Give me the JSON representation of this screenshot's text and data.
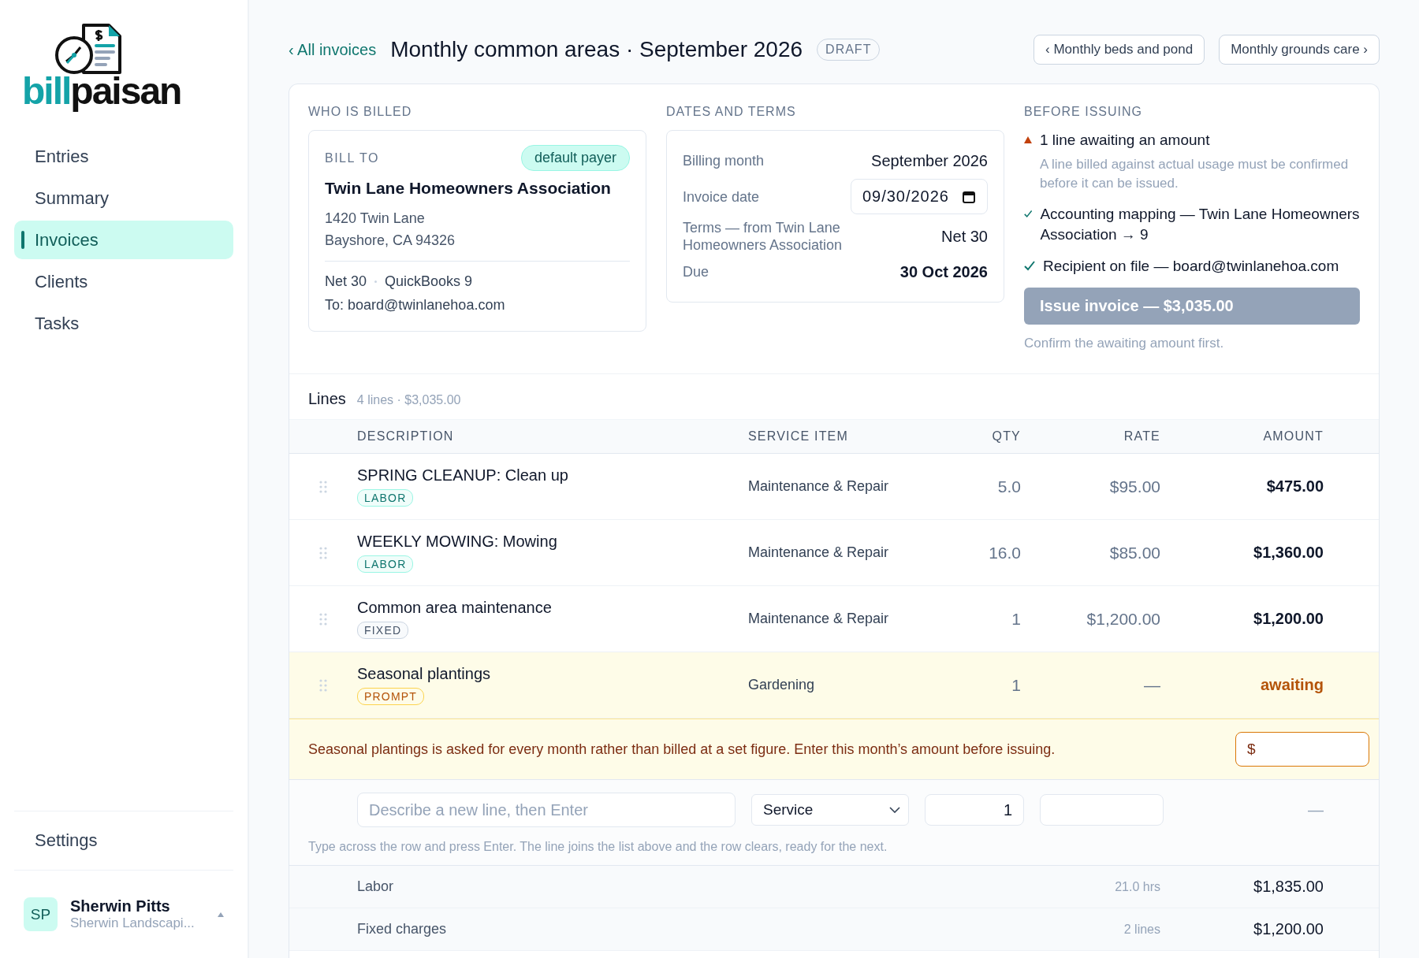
{
  "logo": {
    "part_a": "bill",
    "part_b": "paisan"
  },
  "sidebar": {
    "items": [
      {
        "label": "Entries",
        "selected": false
      },
      {
        "label": "Summary",
        "selected": false
      },
      {
        "label": "Invoices",
        "selected": true
      },
      {
        "label": "Clients",
        "selected": false
      },
      {
        "label": "Tasks",
        "selected": false
      }
    ],
    "settings": "Settings",
    "user": {
      "initials": "SP",
      "name": "Sherwin Pitts",
      "company": "Sherwin Landscapi..."
    }
  },
  "header": {
    "back_link": "‹ All invoices",
    "title": "Monthly common areas · September 2026",
    "status": "DRAFT",
    "prev": "‹ Monthly beds and pond",
    "next": "Monthly grounds care ›"
  },
  "who_is_billed": {
    "heading": "WHO IS BILLED",
    "label": "BILL TO",
    "badge": "default payer",
    "name": "Twin Lane Homeowners Association",
    "address": [
      "1420 Twin Lane",
      "Bayshore, CA 94326"
    ],
    "terms": "Net 30",
    "mapping": "QuickBooks 9",
    "recipient": "To: board@twinlanehoa.com"
  },
  "dates_and_terms": {
    "heading": "DATES AND TERMS",
    "rows": [
      {
        "kind": "text",
        "label": "Billing month",
        "value": "September 2026",
        "strong": false
      },
      {
        "kind": "date",
        "label": "Invoice date",
        "value": "09/30/2026"
      },
      {
        "kind": "text",
        "label": "Terms — from Twin Lane Homeowners Association",
        "value": "Net 30",
        "strong": false
      },
      {
        "kind": "text",
        "label": "Due",
        "value": "30 Oct 2026",
        "strong": true
      }
    ]
  },
  "before_issuing": {
    "heading": "BEFORE ISSUING",
    "checks": [
      {
        "kind": "warning",
        "text": "1 line awaiting an amount",
        "note": "A line billed against actual usage must be confirmed before it can be issued."
      },
      {
        "kind": "ok",
        "text": "Accounting mapping — Twin Lane Homeowners Association → 9"
      },
      {
        "kind": "ok",
        "text": "Recipient on file — board@twinlanehoa.com"
      }
    ],
    "button": {
      "label": "Issue invoice — $3,035.00",
      "disabled": true
    },
    "hint": "Confirm the awaiting amount first."
  },
  "lines": {
    "title": "Lines",
    "summary": "4 lines · $3,035.00",
    "columns": [
      "DESCRIPTION",
      "SERVICE ITEM",
      "QTY",
      "RATE",
      "AMOUNT"
    ],
    "rows": [
      {
        "description": "SPRING CLEANUP: Clean up",
        "tag": "LABOR",
        "kind": "labor",
        "service_item": "Maintenance & Repair",
        "qty": "5.0",
        "rate": "$95.00",
        "amount": "$475.00",
        "awaiting": false
      },
      {
        "description": "WEEKLY MOWING: Mowing",
        "tag": "LABOR",
        "kind": "labor",
        "service_item": "Maintenance & Repair",
        "qty": "16.0",
        "rate": "$85.00",
        "amount": "$1,360.00",
        "awaiting": false
      },
      {
        "description": "Common area maintenance",
        "tag": "FIXED",
        "kind": "fixed",
        "service_item": "Maintenance & Repair",
        "qty": "1",
        "rate": "$1,200.00",
        "amount": "$1,200.00",
        "awaiting": false
      },
      {
        "description": "Seasonal plantings",
        "tag": "PROMPT",
        "kind": "prompt",
        "service_item": "Gardening",
        "qty": "1",
        "rate": "—",
        "amount": "awaiting",
        "awaiting": true
      }
    ],
    "notice": {
      "text": "Seasonal plantings is asked for every month rather than billed at a set figure. Enter this month’s amount before issuing.",
      "amount_prefix": "$"
    },
    "new_line": {
      "placeholder": "Describe a new line, then Enter",
      "service": "Service",
      "qty": "1",
      "amount": "—",
      "hint": "Type across the row and press Enter. The line joins the list above and the row clears, ready for the next."
    },
    "totals": [
      {
        "label": "Labor",
        "detail": "21.0 hrs",
        "amount": "$1,835.00"
      },
      {
        "label": "Fixed charges",
        "detail": "2 lines",
        "amount": "$1,200.00"
      }
    ]
  }
}
